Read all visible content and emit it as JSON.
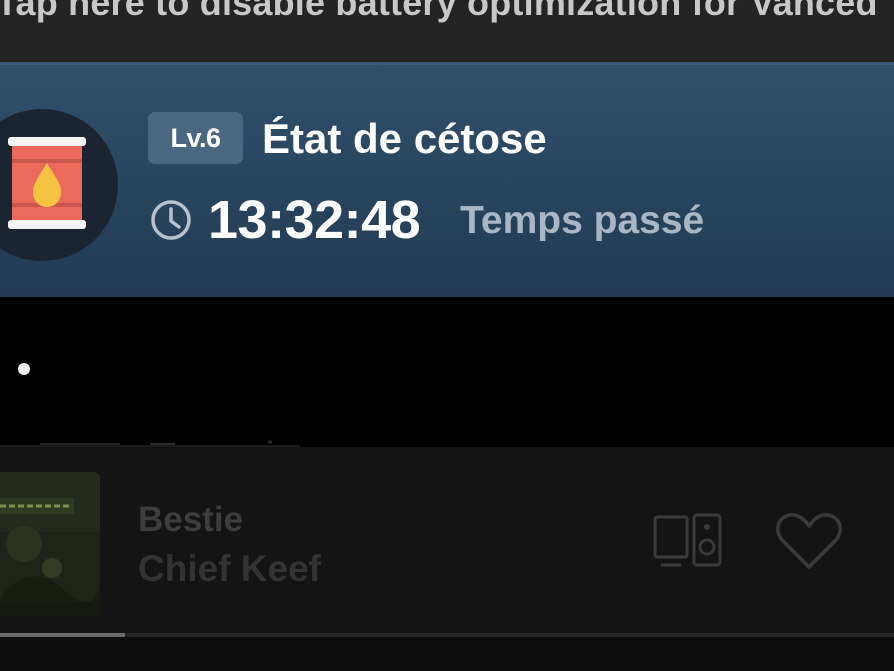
{
  "notification": {
    "text": "Tap here to disable battery optimization for Vanced"
  },
  "ketosis_card": {
    "level_badge": "Lv.6",
    "stage_name": "État de cétose",
    "elapsed_time": "13:32:48",
    "elapsed_label": "Temps passé",
    "icons": {
      "stage": "fuel-barrel-icon",
      "clock": "clock-icon"
    },
    "colors": {
      "card_background": "#2a4761",
      "badge_background": "#4a6882",
      "barrel": "#ec6a5c",
      "drop": "#f5c242"
    }
  },
  "page_indicator": {
    "active_index": 0
  },
  "now_playing": {
    "track_title": "Bestie",
    "artist": "Chief Keef",
    "progress_fraction": 0.14,
    "icons": {
      "devices": "devices-speaker-icon",
      "like": "heart-outline-icon"
    }
  }
}
